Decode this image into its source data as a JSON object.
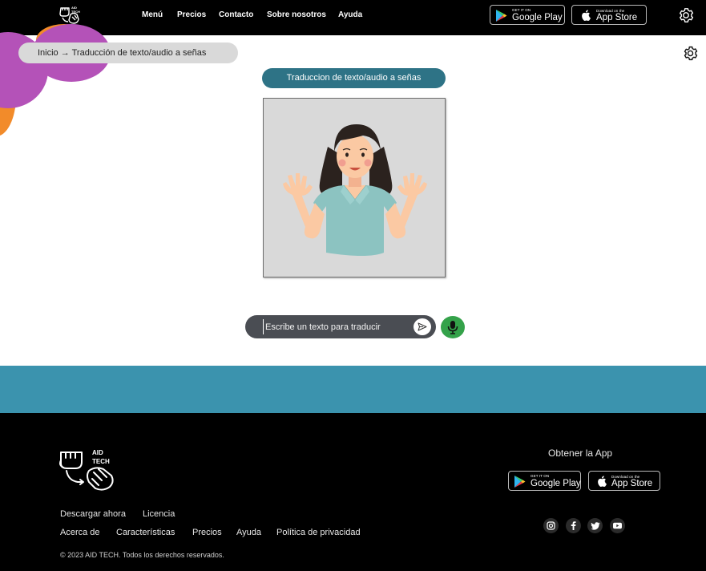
{
  "header": {
    "nav": [
      "Menú",
      "Precios",
      "Contacto",
      "Sobre nosotros",
      "Ayuda"
    ],
    "google_play": {
      "small": "GET IT ON",
      "big": "Google Play"
    },
    "app_store": {
      "small": "Download on the",
      "big": "App Store"
    },
    "settings_icon": "gear-icon"
  },
  "breadcrumb": {
    "home": "Inicio",
    "arrow": "→",
    "current": "Traducción de texto/audio a señas"
  },
  "main": {
    "title": "Traduccion de texto/audio a señas",
    "input_placeholder": "Escribe un texto para traducir",
    "send_icon": "send-icon",
    "mic_icon": "microphone-icon"
  },
  "footer": {
    "brand_line1": "AID",
    "brand_line2": "TECH",
    "links_row1": [
      "Descargar ahora",
      "Licencia"
    ],
    "links_row2": [
      "Acerca de",
      "Características",
      "Precios",
      "Ayuda",
      "Política de privacidad"
    ],
    "copyright": "© 2023 AID TECH. Todos los derechos reservados.",
    "get_app": "Obtener la App",
    "google_play": {
      "small": "GET IT ON",
      "big": "Google Play"
    },
    "app_store": {
      "small": "Download on the",
      "big": "App Store"
    },
    "social": [
      "instagram-icon",
      "facebook-icon",
      "twitter-icon",
      "youtube-icon"
    ]
  },
  "colors": {
    "nav_bg": "#000000",
    "title_pill": "#2e7386",
    "teal_band": "#3b93ae",
    "mic": "#34a24a",
    "input_bg": "#4a4d53",
    "blob_purple": "#b452b8",
    "blob_orange": "#f28b2a"
  }
}
